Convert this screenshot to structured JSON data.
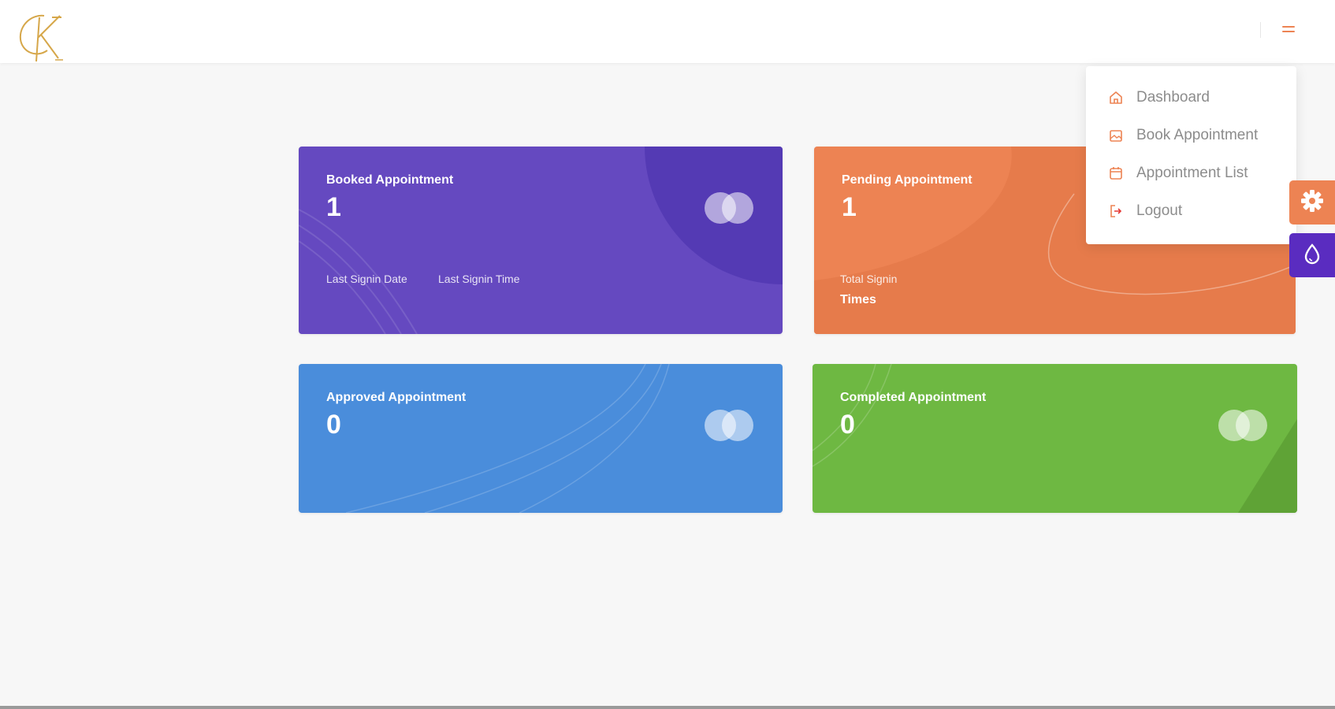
{
  "header": {
    "logo_icon": "monogram-logo-icon",
    "menu_icon": "hamburger-menu-icon"
  },
  "cards": [
    {
      "label": "Booked Appointment",
      "value": "1",
      "sub1": "Last Signin Date",
      "sub2": "Last Signin Time",
      "color": "#6549c0",
      "icon": "overlapping-circles-icon"
    },
    {
      "label": "Pending Appointment",
      "value": "1",
      "sub1": "Total Signin",
      "sub2": "Times",
      "color": "#ed8353"
    },
    {
      "label": "Approved Appointment",
      "value": "0",
      "color": "#4a8ddb",
      "icon": "overlapping-circles-icon"
    },
    {
      "label": "Completed Appointment",
      "value": "0",
      "color": "#6eb842",
      "icon": "overlapping-circles-icon"
    }
  ],
  "dropdown": {
    "items": [
      {
        "label": "Dashboard",
        "icon": "home-icon"
      },
      {
        "label": "Book Appointment",
        "icon": "image-icon"
      },
      {
        "label": "Appointment List",
        "icon": "calendar-icon"
      },
      {
        "label": "Logout",
        "icon": "logout-icon"
      }
    ]
  },
  "side_buttons": [
    {
      "icon": "gear-icon",
      "color": "#ed8353"
    },
    {
      "icon": "droplet-icon",
      "color": "#5a2cc0"
    }
  ],
  "colors": {
    "accent": "#ed8353",
    "page_background": "#f7f7f7",
    "menu_text": "#8c8c8c"
  }
}
